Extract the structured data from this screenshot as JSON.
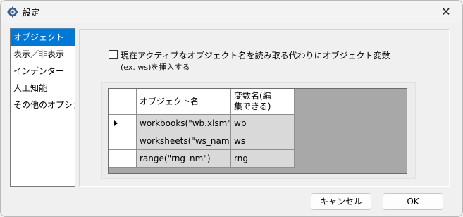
{
  "window": {
    "title": "設定",
    "close_glyph": "✕"
  },
  "nav": {
    "items": [
      {
        "label": "オブジェクト",
        "selected": true
      },
      {
        "label": "表示／非表示",
        "selected": false
      },
      {
        "label": "インデンター",
        "selected": false
      },
      {
        "label": "人工知能",
        "selected": false
      },
      {
        "label": "その他のオプション",
        "selected": false
      }
    ]
  },
  "option": {
    "checked": false,
    "label": "現在アクティブなオブジェクト名を読み取る代わりにオブジェクト変数",
    "sublabel": "(ex. ws)を挿入する"
  },
  "grid": {
    "columns": [
      "オブジェクト名",
      "変数名(編集できる)"
    ],
    "column_lines": [
      [
        "オブジェクト名"
      ],
      [
        "変数名(編",
        "集できる)"
      ]
    ],
    "current_row": 0,
    "rows": [
      [
        "workbooks(\"wb.xlsm\")",
        "wb"
      ],
      [
        "worksheets(\"ws_name\")",
        "ws"
      ],
      [
        "range(\"rng_nm\")",
        "rng"
      ]
    ]
  },
  "buttons": {
    "cancel": "キャンセル",
    "ok": "OK"
  },
  "colors": {
    "selection": "#0078d7",
    "grid_bg": "#a8a8a8"
  }
}
